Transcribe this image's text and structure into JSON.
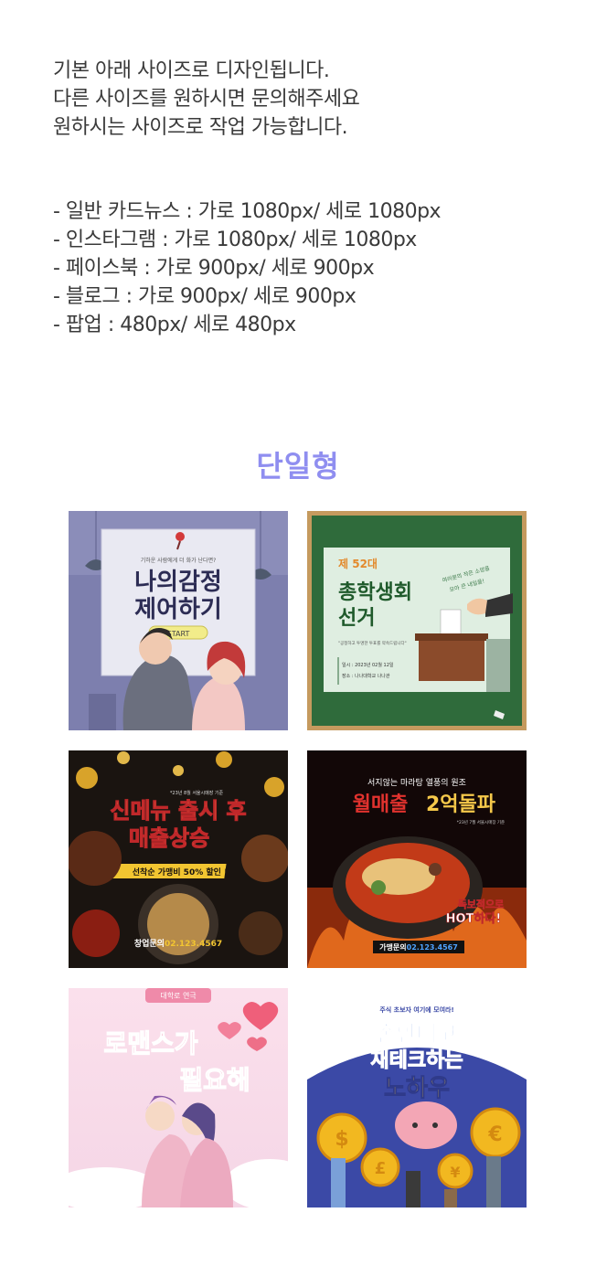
{
  "intro": {
    "lines": [
      "기본 아래 사이즈로 디자인됩니다.",
      "다른 사이즈를 원하시면 문의해주세요",
      "원하시는 사이즈로 작업 가능합니다."
    ]
  },
  "specs": {
    "lines": [
      "- 일반 카드뉴스 : 가로 1080px/ 세로 1080px",
      "- 인스타그램 : 가로 1080px/ 세로 1080px",
      "- 페이스북 : 가로 900px/ 세로 900px",
      "- 블로그 : 가로 900px/ 세로 900px",
      "- 팝업 : 480px/ 세로 480px"
    ]
  },
  "section": {
    "title": "단일형",
    "color": "#8f8ef0"
  },
  "thumbnails": [
    {
      "subtitle": "기하운 사람에게 더 화가 난다면?",
      "title_line1": "나의감정",
      "title_line2": "제어하기",
      "button": "START"
    },
    {
      "label": "제 52대",
      "title_line1": "총학생회",
      "title_line2": "선거",
      "note": "\"공정하고 투명한 투표를 약속드립니다\"",
      "date": "일시 : 2023년 02월 12일",
      "place": "장소 : 나나대학교 나나관",
      "handwriting_line1": "여러분의 작은 소망을",
      "handwriting_line2": "모아 큰 내일을!"
    },
    {
      "small": "*23년 8월 서울시매장 기준",
      "title_line1": "신메뉴 출시 후",
      "title_line2": "매출상승",
      "banner": "선착순 가맹비 50% 할인 !!",
      "contact_label": "창업문의",
      "contact_number": "02.123.4567"
    },
    {
      "top": "서지않는 마라탕 열풍의 원조",
      "title_a": "월매출",
      "title_b": "2억돌파",
      "small": "*23년 7월 서울시매장 기준",
      "tag_line1": "독보적으로",
      "tag_line2": "HOT하다!",
      "contact_label": "가맹문의",
      "contact_number": "02.123.4567"
    },
    {
      "badge": "대학로 연극",
      "title_line1": "로맨스가",
      "title_line2": "필요해"
    },
    {
      "top": "주식 초보자 여기에 모여라!",
      "title_line1": "손안대고",
      "title_line2": "재테크하는",
      "title_line3": "노하우"
    }
  ]
}
